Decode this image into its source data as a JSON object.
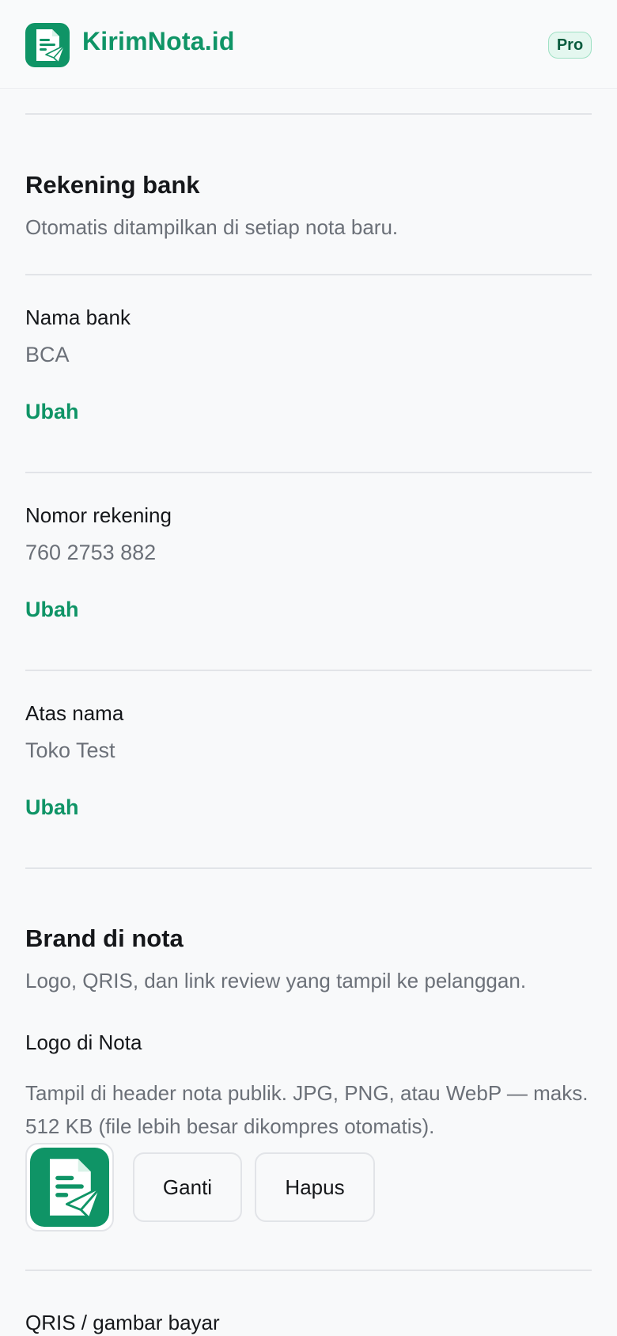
{
  "header": {
    "brand_name": "KirimNota.id",
    "brand_icon": "invoice-paper-plane-icon",
    "plan_badge": "Pro"
  },
  "bank_section": {
    "title": "Rekening bank",
    "description": "Otomatis ditampilkan di setiap nota baru.",
    "fields": [
      {
        "label": "Nama bank",
        "value": "BCA",
        "action": "Ubah"
      },
      {
        "label": "Nomor rekening",
        "value": "760 2753 882",
        "action": "Ubah"
      },
      {
        "label": "Atas nama",
        "value": "Toko Test",
        "action": "Ubah"
      }
    ]
  },
  "brand_section": {
    "title": "Brand di nota",
    "description": "Logo, QRIS, dan link review yang tampil ke pelanggan.",
    "logo": {
      "label": "Logo di Nota",
      "description": "Tampil di header nota publik. JPG, PNG, atau WebP — maks. 512 KB (file lebih besar dikompres otomatis).",
      "replace_label": "Ganti",
      "delete_label": "Hapus"
    },
    "qris": {
      "label": "QRIS / gambar bayar"
    }
  },
  "colors": {
    "accent": "#0f9466",
    "badge_bg": "#e4f7ef",
    "muted_text": "#6b7078",
    "divider": "#e2e4e8"
  }
}
